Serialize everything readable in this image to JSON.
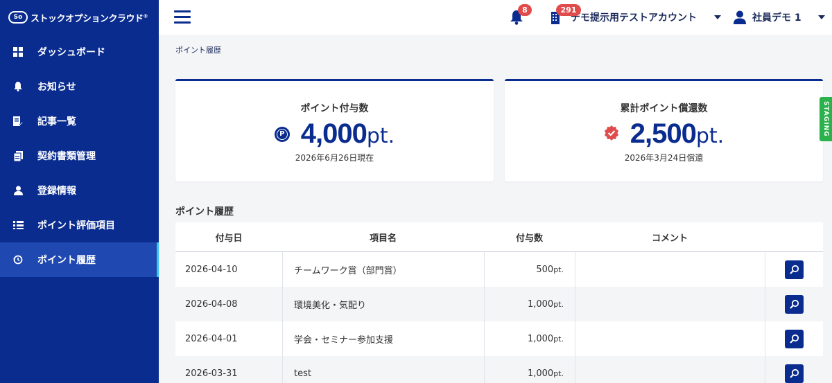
{
  "app": {
    "logo_badge": "So",
    "logo_text": "ストックオプションクラウド",
    "logo_mark": "®"
  },
  "sidebar": {
    "items": [
      {
        "label": "ダッシュボード",
        "icon": "grid-icon"
      },
      {
        "label": "お知らせ",
        "icon": "bell-icon"
      },
      {
        "label": "記事一覧",
        "icon": "edit-document-icon"
      },
      {
        "label": "契約書類管理",
        "icon": "documents-icon"
      },
      {
        "label": "登録情報",
        "icon": "user-icon"
      },
      {
        "label": "ポイント評価項目",
        "icon": "list-icon"
      },
      {
        "label": "ポイント履歴",
        "icon": "history-icon",
        "active": true
      }
    ]
  },
  "header": {
    "notification_count": "8",
    "account_count": "291",
    "account_name": "デモ提示用テストアカウント",
    "user_name": "社員デモ 1"
  },
  "breadcrumb": "ポイント履歴",
  "cards": {
    "granted": {
      "title": "ポイント付与数",
      "value": "4,000",
      "unit": "pt.",
      "date": "2026年6月26日現在"
    },
    "redeemed": {
      "title": "累計ポイント償還数",
      "value": "2,500",
      "unit": "pt.",
      "date": "2026年3月24日償還"
    }
  },
  "staging_label": "STAGING",
  "history": {
    "title": "ポイント履歴",
    "columns": [
      "付与日",
      "項目名",
      "付与数",
      "コメント"
    ],
    "rows": [
      {
        "date": "2026-04-10",
        "item": "チームワーク賞（部門賞）",
        "amount": "500",
        "unit": "pt.",
        "comment": ""
      },
      {
        "date": "2026-04-08",
        "item": "環境美化・気配り",
        "amount": "1,000",
        "unit": "pt.",
        "comment": ""
      },
      {
        "date": "2026-04-01",
        "item": "学会・セミナー参加支援",
        "amount": "1,000",
        "unit": "pt.",
        "comment": ""
      },
      {
        "date": "2026-03-31",
        "item": "test",
        "amount": "1,000",
        "unit": "pt.",
        "comment": ""
      }
    ]
  },
  "colors": {
    "sidebar": "#0a2c8f",
    "active": "#1f48b0",
    "accent": "#35c6ee",
    "badge": "#e04b4b",
    "staging": "#2bb24c"
  }
}
